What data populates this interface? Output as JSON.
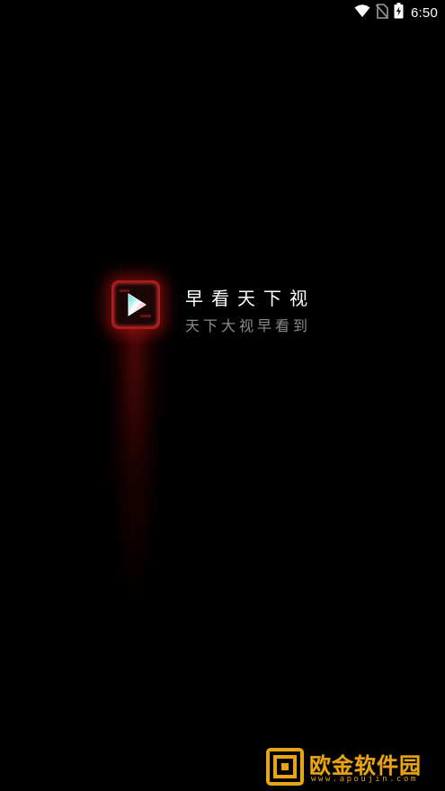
{
  "status_bar": {
    "time": "6:50",
    "icons": [
      "wifi-icon",
      "no-sim-icon",
      "battery-charging-icon"
    ]
  },
  "splash": {
    "app_title": "早看天下视",
    "slogan": "天下大视早看到",
    "logo_icon": "play-icon"
  },
  "watermark": {
    "name": "欧金软件园",
    "url": "www.apoujin.com"
  },
  "colors": {
    "background": "#000000",
    "logo_glow": "#d21414",
    "title": "#ffffff",
    "slogan": "#8a8a8a",
    "watermark": "#e8a414"
  }
}
